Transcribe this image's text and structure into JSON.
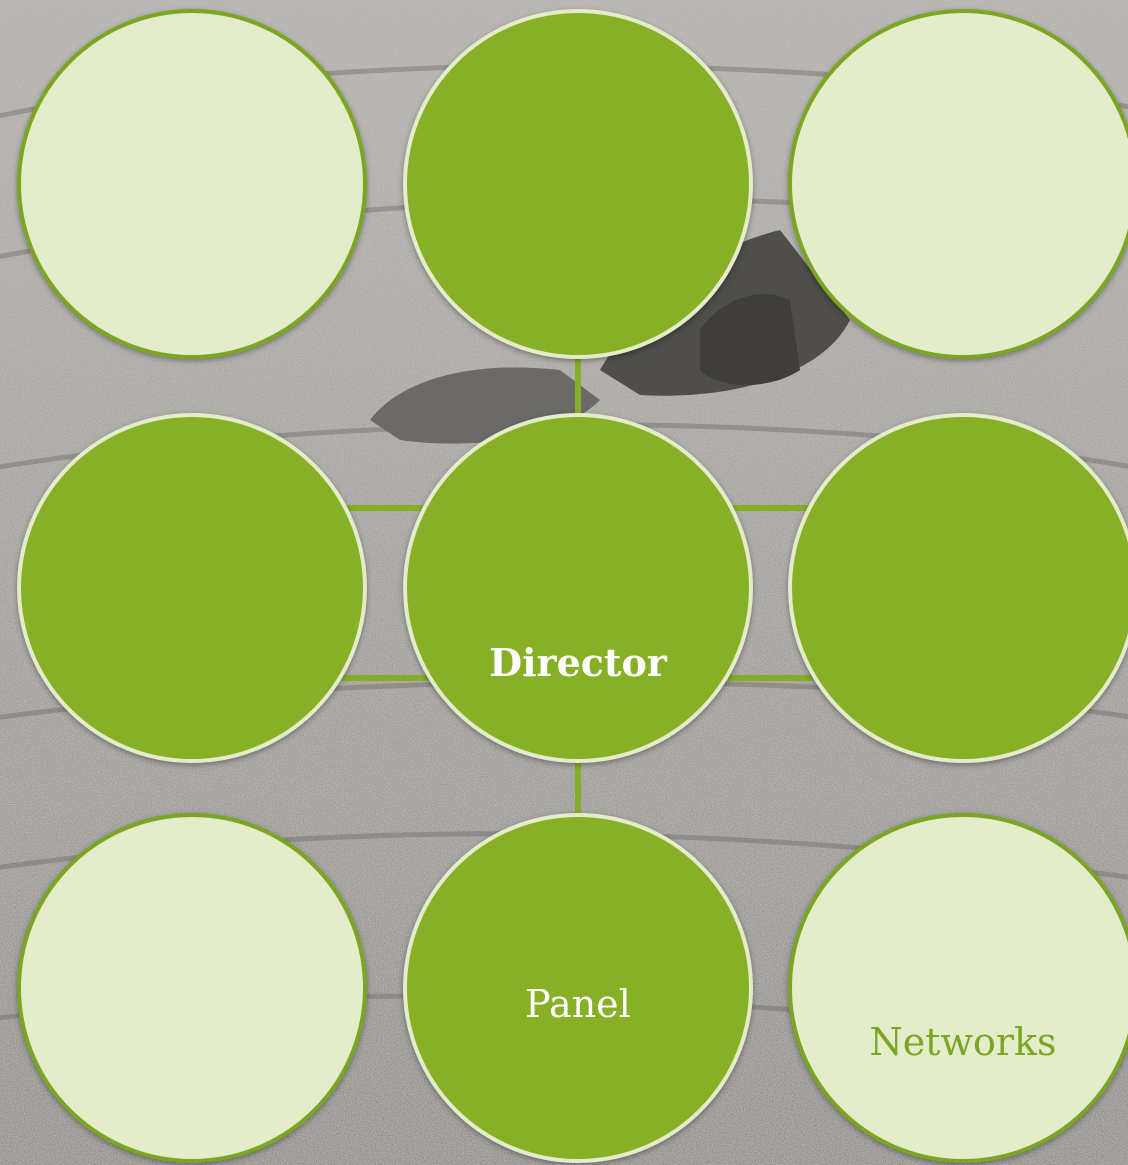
{
  "theme": {
    "dark_green": "#88b027",
    "light_green": "#e5ecca",
    "accent_green": "#7aa623",
    "connector": "#86ad28"
  },
  "nodes": {
    "top_left": {
      "label": "",
      "style": "light"
    },
    "top_center": {
      "label": "",
      "style": "dark"
    },
    "top_right": {
      "label": "",
      "style": "light"
    },
    "mid_left": {
      "label": "",
      "style": "dark"
    },
    "center": {
      "label": "Director",
      "style": "dark"
    },
    "mid_right": {
      "label": "",
      "style": "dark"
    },
    "bot_left": {
      "label": "",
      "style": "light"
    },
    "bot_center": {
      "label": "Panel",
      "style": "dark"
    },
    "bot_right": {
      "label": "Networks",
      "style": "light"
    }
  },
  "edges": [
    {
      "from": "center",
      "to": "top_center"
    },
    {
      "from": "center",
      "to": "bot_center"
    },
    {
      "from": "center",
      "to": "mid_left"
    },
    {
      "from": "center",
      "to": "mid_right"
    }
  ]
}
